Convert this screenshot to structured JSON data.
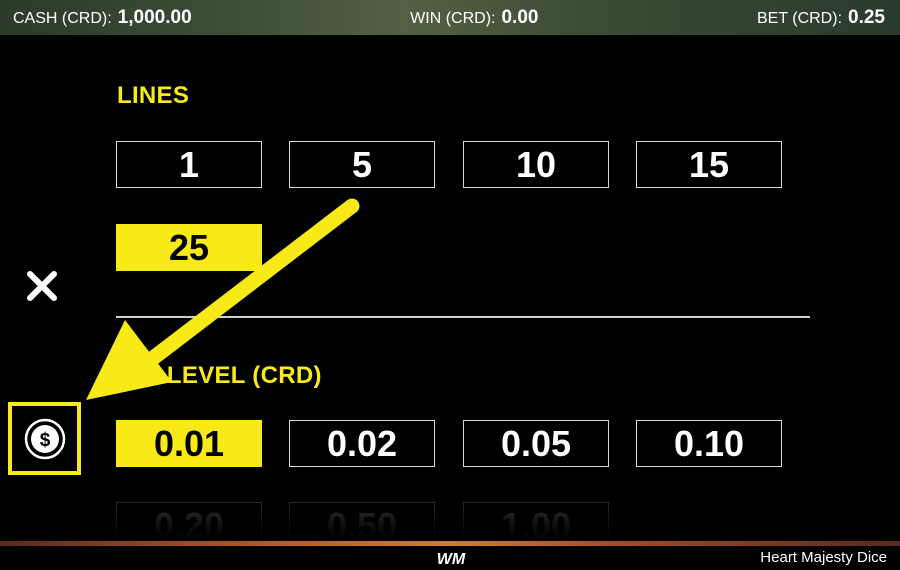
{
  "topbar": {
    "cash_label": "CASH (CRD):",
    "cash_value": "1,000.00",
    "win_label": "WIN (CRD):",
    "win_value": "0.00",
    "bet_label": "BET (CRD):",
    "bet_value": "0.25"
  },
  "lines": {
    "title": "LINES",
    "options": [
      "1",
      "5",
      "10",
      "15",
      "25"
    ],
    "selected": "25"
  },
  "coin_level": {
    "title_visible": "T LEVEL (CRD)",
    "options": [
      "0.01",
      "0.02",
      "0.05",
      "0.10",
      "0.20",
      "0.50",
      "1.00"
    ],
    "selected": "0.01"
  },
  "footer": {
    "brand": "WM",
    "game_name": "Heart Majesty Dice"
  },
  "icons": {
    "close": "close-icon",
    "coin": "dollar-coin-icon",
    "pointer": "arrow-pointer-icon"
  },
  "colors": {
    "accent": "#f7ea17",
    "background": "#000000",
    "option_border": "#d8d8d8"
  }
}
